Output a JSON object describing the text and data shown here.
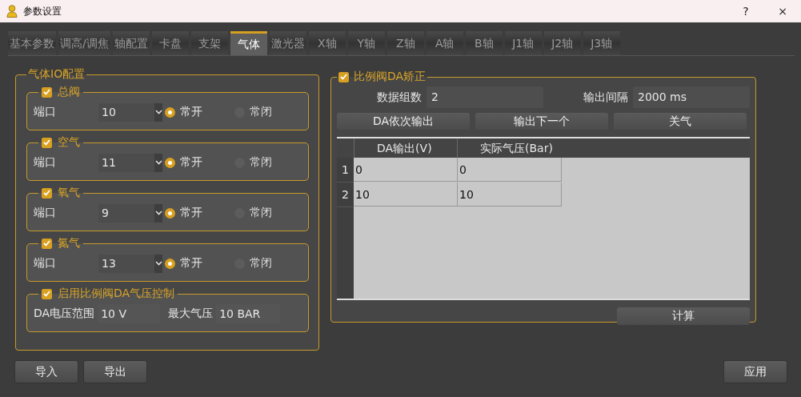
{
  "window": {
    "title": "参数设置",
    "buttons": [
      "?",
      "×"
    ]
  },
  "tabs": [
    {
      "label": "基本参数",
      "selected": false
    },
    {
      "label": "调高/调焦",
      "selected": false
    },
    {
      "label": "轴配置",
      "selected": false
    },
    {
      "label": "卡盘",
      "selected": false
    },
    {
      "label": "支架",
      "selected": false
    },
    {
      "label": "气体",
      "selected": true
    },
    {
      "label": "激光器",
      "selected": false
    },
    {
      "label": "X轴",
      "selected": false
    },
    {
      "label": "Y轴",
      "selected": false
    },
    {
      "label": "Z轴",
      "selected": false
    },
    {
      "label": "A轴",
      "selected": false
    },
    {
      "label": "B轴",
      "selected": false
    },
    {
      "label": "J1轴",
      "selected": false
    },
    {
      "label": "J2轴",
      "selected": false
    },
    {
      "label": "J3轴",
      "selected": false
    }
  ],
  "gas_io_config": {
    "title": "气体IO配置",
    "groups": [
      {
        "label": "总阀",
        "checked": true,
        "port_label": "端口",
        "port_value": "10",
        "options": [
          {
            "label": "常开",
            "selected": true
          },
          {
            "label": "常闭",
            "selected": false
          }
        ]
      },
      {
        "label": "空气",
        "checked": true,
        "port_label": "端口",
        "port_value": "11",
        "options": [
          {
            "label": "常开",
            "selected": true
          },
          {
            "label": "常闭",
            "selected": false
          }
        ]
      },
      {
        "label": "氧气",
        "checked": true,
        "port_label": "端口",
        "port_value": "9",
        "options": [
          {
            "label": "常开",
            "selected": true
          },
          {
            "label": "常闭",
            "selected": false
          }
        ]
      },
      {
        "label": "氮气",
        "checked": true,
        "port_label": "端口",
        "port_value": "13",
        "options": [
          {
            "label": "常开",
            "selected": true
          },
          {
            "label": "常闭",
            "selected": false
          }
        ]
      }
    ],
    "da_control": {
      "label": "启用比例阀DA气压控制",
      "checked": true,
      "fields": [
        {
          "label": "DA电压范围",
          "value": "10 V"
        },
        {
          "label": "最大气压",
          "value": "10 BAR"
        }
      ]
    }
  },
  "da_calibration": {
    "label": "比例阀DA矫正",
    "checked": true,
    "fields": [
      {
        "label": "数据组数",
        "value": "2"
      },
      {
        "label": "输出间隔",
        "value": "2000 ms"
      }
    ],
    "buttons": [
      "DA依次输出",
      "输出下一个",
      "关气"
    ],
    "table": {
      "columns": [
        "DA输出(V)",
        "实际气压(Bar)"
      ],
      "rows": [
        {
          "header": "1",
          "cells": [
            "0",
            "0"
          ]
        },
        {
          "header": "2",
          "cells": [
            "10",
            "10"
          ]
        }
      ]
    },
    "calc_button": "计算"
  },
  "footer": {
    "left_buttons": [
      "导入",
      "导出"
    ],
    "right_buttons": [
      "应用"
    ]
  }
}
